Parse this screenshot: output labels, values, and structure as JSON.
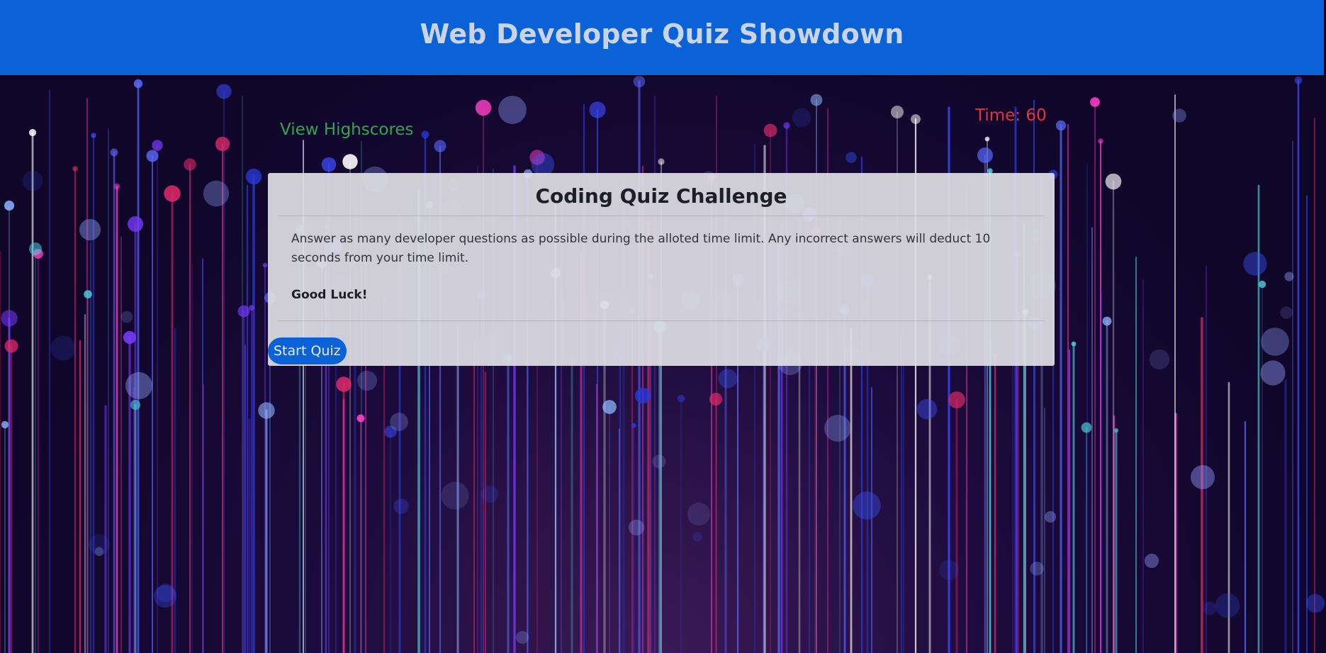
{
  "header": {
    "title": "Web Developer Quiz Showdown"
  },
  "nav": {
    "highscores_label": "View Highscores",
    "timer_text": "Time: 60"
  },
  "quiz_card": {
    "title": "Coding Quiz Challenge",
    "description": "Answer as many developer questions as possible during the alloted time limit. Any incorrect answers will deduct 10 seconds from your time limit.",
    "good_luck": "Good Luck!",
    "start_button_label": "Start Quiz"
  },
  "colors": {
    "header_bg": "#0a62d6",
    "highscores_link": "#2ea84a",
    "timer": "#e8323c",
    "button_bg": "#0a62d6"
  }
}
